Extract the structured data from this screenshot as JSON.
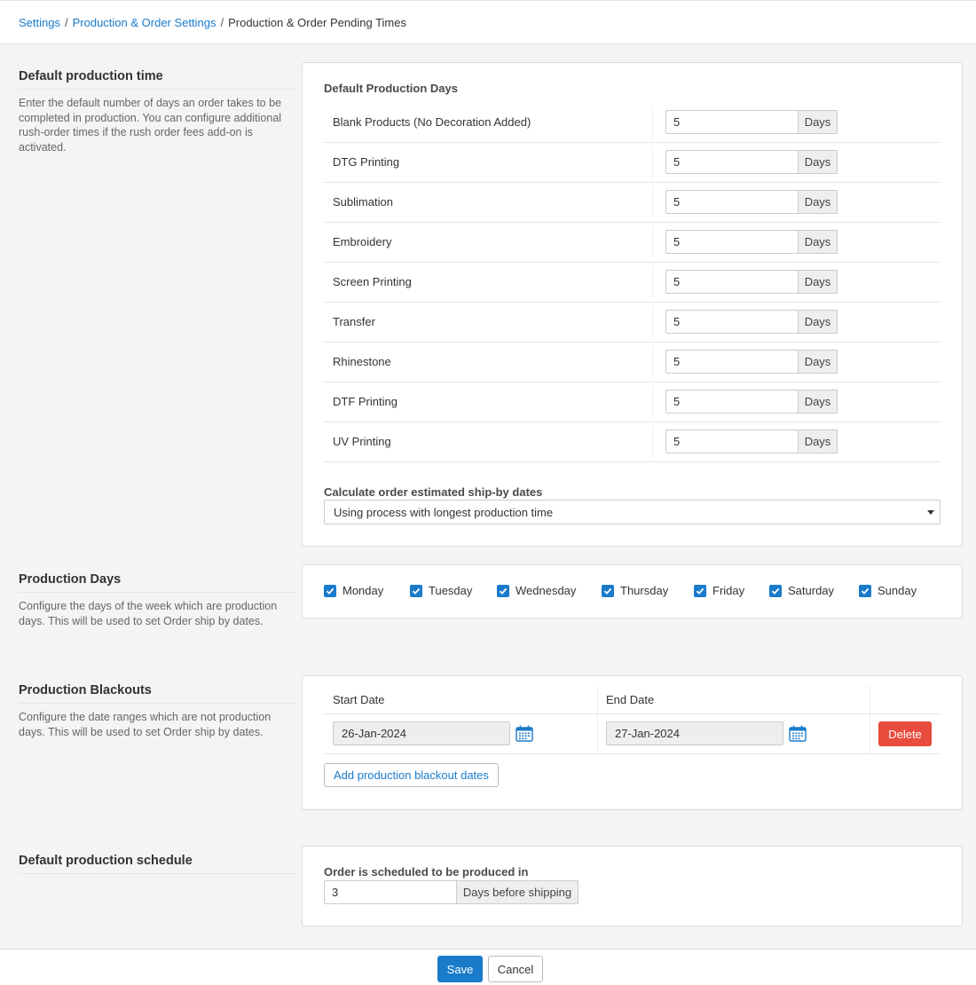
{
  "breadcrumb": {
    "items": [
      "Settings",
      "Production & Order Settings"
    ],
    "current": "Production & Order Pending Times",
    "separator": "/"
  },
  "default_production_time": {
    "title": "Default production time",
    "description": "Enter the default number of days an order takes to be completed in production. You can configure additional rush-order times if the rush order fees add-on is activated.",
    "card_heading": "Default Production Days",
    "unit": "Days",
    "rows": [
      {
        "label": "Blank Products (No Decoration Added)",
        "value": "5"
      },
      {
        "label": "DTG Printing",
        "value": "5"
      },
      {
        "label": "Sublimation",
        "value": "5"
      },
      {
        "label": "Embroidery",
        "value": "5"
      },
      {
        "label": "Screen Printing",
        "value": "5"
      },
      {
        "label": "Transfer",
        "value": "5"
      },
      {
        "label": "Rhinestone",
        "value": "5"
      },
      {
        "label": "DTF Printing",
        "value": "5"
      },
      {
        "label": "UV Printing",
        "value": "5"
      }
    ],
    "ship_by_label": "Calculate order estimated ship-by dates",
    "ship_by_selected": "Using process with longest production time"
  },
  "production_days": {
    "title": "Production Days",
    "description": "Configure the days of the week which are production days. This will be used to set Order ship by dates.",
    "days": [
      {
        "label": "Monday",
        "checked": true
      },
      {
        "label": "Tuesday",
        "checked": true
      },
      {
        "label": "Wednesday",
        "checked": true
      },
      {
        "label": "Thursday",
        "checked": true
      },
      {
        "label": "Friday",
        "checked": true
      },
      {
        "label": "Saturday",
        "checked": true
      },
      {
        "label": "Sunday",
        "checked": true
      }
    ]
  },
  "production_blackouts": {
    "title": "Production Blackouts",
    "description": "Configure the date ranges which are not production days. This will be used to set Order ship by dates.",
    "start_header": "Start Date",
    "end_header": "End Date",
    "rows": [
      {
        "start": "26-Jan-2024",
        "end": "27-Jan-2024",
        "delete_label": "Delete"
      }
    ],
    "add_label": "Add production blackout dates"
  },
  "default_schedule": {
    "title": "Default production schedule",
    "label": "Order is scheduled to be produced in",
    "value": "3",
    "unit": "Days before shipping"
  },
  "footer": {
    "save_label": "Save",
    "cancel_label": "Cancel"
  },
  "colors": {
    "accent": "#1a7bcb",
    "danger": "#e74c3c"
  }
}
